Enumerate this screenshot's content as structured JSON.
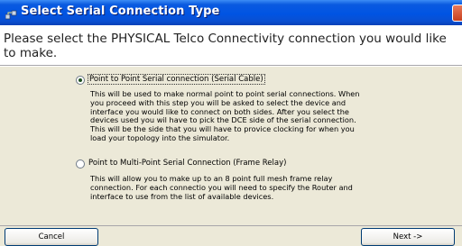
{
  "window": {
    "title": "Select Serial Connection Type"
  },
  "heading": "Please select the PHYSICAL Telco Connectivity connection you would like to make.",
  "options": [
    {
      "label": "Point to Point Serial connection (Serial Cable)",
      "selected": true,
      "description": [
        "This will be used to make normal point to point serial connections. When",
        "you proceed with this step you will be asked to select the device and",
        "interface you would like to connect on both sides.  After you select the",
        "devices used you wil have to pick the DCE side of the serial connection.",
        "This will be the side that you will have to provice clocking for when you",
        "load your topology into the simulator."
      ]
    },
    {
      "label": "Point to Multi-Point Serial Connection (Frame Relay)",
      "selected": false,
      "description": [
        "This will allow you to make up to an 8 point full mesh frame relay",
        "connection. For each connectio you will need to specify the Router and",
        "interface to use from the list of available devices."
      ]
    }
  ],
  "buttons": {
    "cancel": "Cancel",
    "next": "Next ->"
  },
  "colors": {
    "titlebar": "#0054e3",
    "dialog_bg": "#ece9d8",
    "close_button": "#c8401f"
  }
}
